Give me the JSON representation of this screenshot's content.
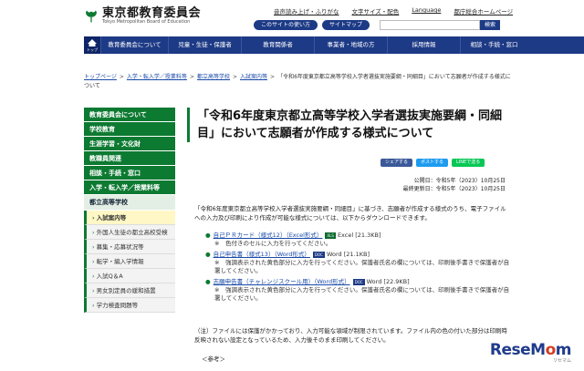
{
  "header": {
    "logo_ja": "東京都教育委員会",
    "logo_en": "Tokyo Metropolitan Board of Education",
    "util_links": [
      "音声読み上げ・ふりがな",
      "文字サイズ・配色",
      "Language",
      "都庁総合ホームページ"
    ],
    "util_buttons": [
      "このサイトの使い方",
      "サイトマップ"
    ],
    "search_placeholder": "",
    "search_label": "検索"
  },
  "gnav": {
    "home_label": "トップ",
    "items": [
      "教育委員会について",
      "児童・生徒・保護者",
      "教育関係者",
      "事業者・地域の方",
      "採用情報",
      "相談・手続・窓口"
    ]
  },
  "breadcrumb": {
    "links": [
      "トップページ",
      "入学・転入学／授業料等",
      "都立高等学校",
      "入試案内等"
    ],
    "current": "「令和6年度東京都立高等学校入学者選抜実施要綱・同細目」において志願者が作成する様式について"
  },
  "sidebar": {
    "top_items": [
      "教育委員会について",
      "学校教育",
      "生涯学習・文化財",
      "教職員関連",
      "相談・手続・窓口",
      "入学・転入学／授業料等"
    ],
    "section_head": "都立高等学校",
    "sub_items": [
      "入試案内等",
      "外国人生徒の都立高校受検",
      "募集・応募状況等",
      "転学・編入学情報",
      "入試Q＆A",
      "男女別定員の緩和措置",
      "学力検査問題等"
    ],
    "active_index": 0
  },
  "main": {
    "title": "「令和6年度東京都立高等学校入学者選抜実施要綱・同細目」において志願者が作成する様式について",
    "share": [
      {
        "label": "シェアする",
        "color": "#3b5998"
      },
      {
        "label": "ポストする",
        "color": "#1d9bf0"
      },
      {
        "label": "LINEで送る",
        "color": "#06c755"
      }
    ],
    "published": "公開日：令和5年（2023）10月25日",
    "updated": "最終更新日：令和5年（2023）10月25日",
    "intro": "「令和6年度東京都立高等学校入学者選抜実施要綱・同細目」に基づき、志願者が作成する様式のうち、電子ファイルへの入力及び印刷により作成が可能な様式については、以下からダウンロードできます。",
    "files": [
      {
        "link": "自己ＰＲカード（様式12）（Excel形式）",
        "badge": "XLS",
        "type": "Excel",
        "size": "[21.3KB]",
        "note": "※　色付きのセルに入力を行ってください。"
      },
      {
        "link": "自己申告書（様式13）（Word形式）",
        "badge": "DOC",
        "type": "Word",
        "size": "[21.1KB]",
        "note": "※　強調表示された黄色部分に入力を行ってください。保護者氏名の欄については、印刷後手書きで保護者が自署してください。"
      },
      {
        "link": "志願申告書（チャレンジスクール用）（Word形式）",
        "badge": "DOC",
        "type": "Word",
        "size": "[22.9KB]",
        "note": "※　強調表示された黄色部分に入力を行ってください。保護者氏名の欄については、印刷後手書きで保護者が自署してください。"
      }
    ],
    "caution": "（注）ファイルには保護がかかっており、入力可能な領域が制限されています。ファイル内の色の付いた部分は印刷時反映されない設定となっているため、入力後そのまま印刷してください。",
    "ref": "＜参考＞"
  },
  "watermark": {
    "brand_prefix": "ReseM",
    "brand_o": "o",
    "brand_suffix": "m",
    "sub": "リセマム"
  }
}
